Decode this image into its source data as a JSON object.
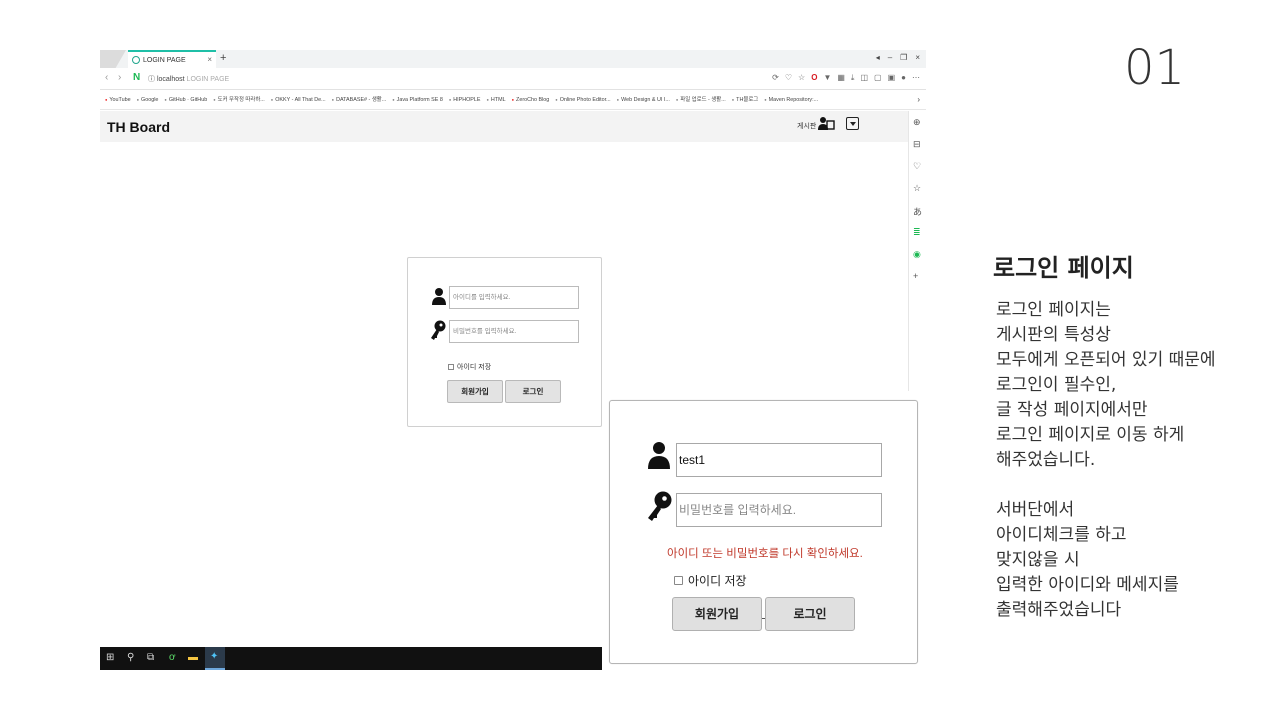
{
  "slide": {
    "number": "01"
  },
  "side": {
    "title": "로그인 페이지",
    "lines": [
      "로그인 페이지는",
      "게시판의 특성상",
      "모두에게 오픈되어 있기 때문에",
      "로그인이 필수인,",
      "글 작성 페이지에서만",
      "로그인 페이지로 이동 하게",
      "해주었습니다.",
      "",
      "서버단에서",
      "아이디체크를 하고",
      "맞지않을 시",
      "입력한 아이디와 메세지를",
      "출력해주었습니다"
    ]
  },
  "browser": {
    "tab_title": "LOGIN PAGE",
    "tab_close": "×",
    "new_tab": "+",
    "window_controls": [
      "◂",
      "–",
      "❐",
      "×"
    ],
    "url_host": "localhost",
    "url_path": "LOGIN PAGE",
    "bookmarks": [
      {
        "label": "YouTube",
        "red": true
      },
      {
        "label": "Google",
        "red": false
      },
      {
        "label": "GitHub · GitHub",
        "red": false
      },
      {
        "label": "도커 무작정 따라하...",
        "red": false
      },
      {
        "label": "OKKY - All That De...",
        "red": false
      },
      {
        "label": "DATABASE# - 생활...",
        "red": false
      },
      {
        "label": "Java Platform SE 8",
        "red": false
      },
      {
        "label": "HIPHOPLE",
        "red": false
      },
      {
        "label": "HTML",
        "red": false
      },
      {
        "label": "ZeroCho Blog",
        "red": true
      },
      {
        "label": "Online Photo Editor...",
        "red": false
      },
      {
        "label": "Web Design & UI I...",
        "red": false
      },
      {
        "label": "파일 업로드 - 생활...",
        "red": false
      },
      {
        "label": "TH블로그",
        "red": false
      },
      {
        "label": "Maven Repository:...",
        "red": false
      }
    ],
    "site_brand": "TH Board",
    "header_board": "게시판"
  },
  "login_small": {
    "id_placeholder": "아이디를 입력하세요.",
    "pw_placeholder": "비밀번호를 입력하세요.",
    "remember_label": "아이디 저장",
    "signup_label": "회원가입",
    "login_label": "로그인"
  },
  "login_big": {
    "id_value": "test1",
    "pw_placeholder": "비밀번호를 입력하세요.",
    "error_message": "아이디 또는 비밀번호를 다시 확인하세요.",
    "remember_label": "아이디 저장",
    "signup_label": "회원가입",
    "login_label": "로그인"
  }
}
